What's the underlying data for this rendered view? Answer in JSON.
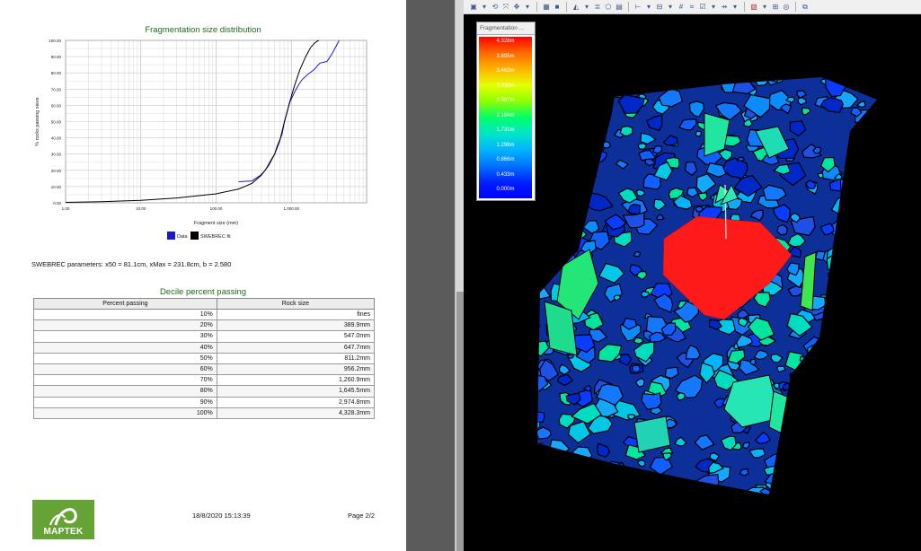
{
  "report": {
    "chart_title": "Fragmentation size distribution",
    "params_text": "SWEBREC parameters: x50 = 81.1cm, xMax = 231.8cm, b = 2.580",
    "decile_title": "Decile percent passing",
    "table_headers": [
      "Percent passing",
      "Rock size"
    ],
    "table_rows": [
      [
        "10%",
        "fines"
      ],
      [
        "20%",
        "389.9mm"
      ],
      [
        "30%",
        "547.0mm"
      ],
      [
        "40%",
        "647.7mm"
      ],
      [
        "50%",
        "811.2mm"
      ],
      [
        "60%",
        "956.2mm"
      ],
      [
        "70%",
        "1,260.9mm"
      ],
      [
        "80%",
        "1,645.5mm"
      ],
      [
        "90%",
        "2,974.8mm"
      ],
      [
        "100%",
        "4,328.3mm"
      ]
    ],
    "logo_text": "MAPTEK",
    "footer_date": "18/8/2020 15:13:39",
    "footer_page": "Page 2/2"
  },
  "chart_data": {
    "type": "line",
    "title": "",
    "xlabel": "Fragment size (mm)",
    "ylabel": "% rocks passing sieve",
    "xscale": "log",
    "xlim": [
      1,
      10000
    ],
    "ylim": [
      0,
      100
    ],
    "xticks": [
      "1.00",
      "10.00",
      "100.00",
      "1,000.00"
    ],
    "yticks": [
      "0.00",
      "10.00",
      "20.00",
      "30.00",
      "40.00",
      "50.00",
      "60.00",
      "70.00",
      "80.00",
      "90.00",
      "100.00"
    ],
    "legend_position": "bottom",
    "series": [
      {
        "name": "Data",
        "color": "#1a1acc",
        "x": [
          200,
          300,
          390,
          450,
          547,
          600,
          648,
          750,
          811,
          880,
          956,
          1100,
          1261,
          1400,
          1646,
          2000,
          2400,
          2975,
          3500,
          4328
        ],
        "y": [
          13,
          13.5,
          17,
          20,
          27,
          30,
          35,
          42,
          50,
          56,
          62,
          68,
          73,
          76,
          79,
          82,
          86,
          87,
          92,
          100
        ]
      },
      {
        "name": "SWEBREC fit",
        "color": "#000000",
        "x": [
          1,
          3,
          10,
          30,
          100,
          200,
          300,
          400,
          500,
          600,
          700,
          811,
          950,
          1100,
          1300,
          1550,
          1800,
          2000,
          2200,
          2318
        ],
        "y": [
          0.3,
          0.7,
          1.5,
          3.0,
          5.5,
          8.5,
          12.0,
          17.0,
          23.0,
          30.0,
          38.0,
          50.0,
          62.0,
          72.0,
          82.0,
          90.0,
          95.5,
          98.0,
          99.5,
          100
        ]
      }
    ]
  },
  "viewer": {
    "legend_title": "Fragmentation ...",
    "legend_values": [
      "4.328m",
      "3.895m",
      "3.463m",
      "3.030m",
      "2.597m",
      "2.164m",
      "1.731m",
      "1.298m",
      "0.866m",
      "0.433m",
      "0.000m"
    ]
  }
}
